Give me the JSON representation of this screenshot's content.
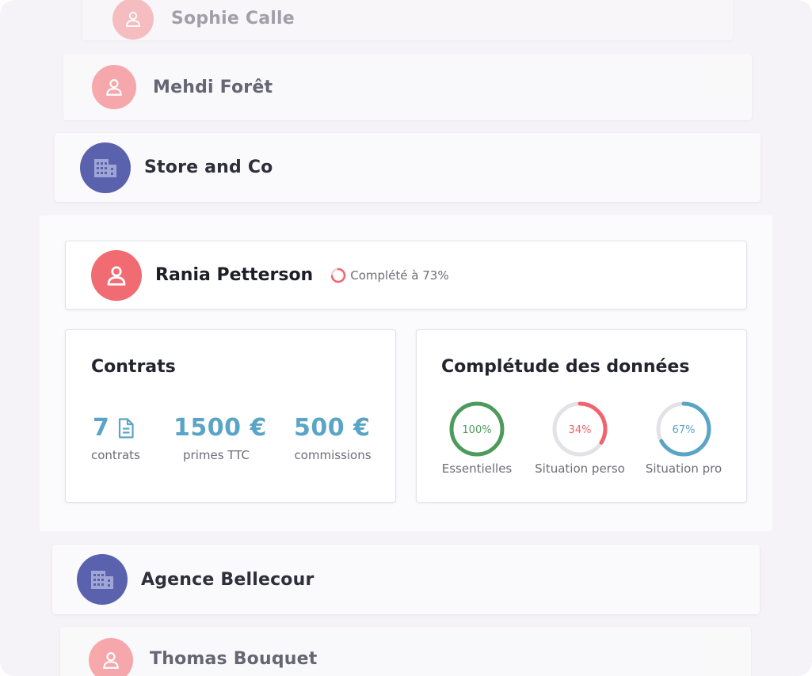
{
  "list_above": [
    {
      "name": "Sophie Calle",
      "type": "person"
    },
    {
      "name": "Mehdi Forêt",
      "type": "person"
    },
    {
      "name": "Store and Co",
      "type": "organization"
    }
  ],
  "selected": {
    "name": "Rania Petterson",
    "completion_text": "Complété à 73%",
    "completion_fraction": 0.73,
    "contracts": {
      "title": "Contrats",
      "count_value": "7",
      "count_label": "contrats",
      "premiums_value": "1500 €",
      "premiums_label": "primes TTC",
      "commissions_value": "500 €",
      "commissions_label": "commissions"
    },
    "data_completeness": {
      "title": "Complétude des données",
      "items": [
        {
          "percent_text": "100%",
          "fraction": 1.0,
          "label": "Essentielles",
          "color": "#4e9a5c"
        },
        {
          "percent_text": "34%",
          "fraction": 0.34,
          "label": "Situation perso",
          "color": "#f06470"
        },
        {
          "percent_text": "67%",
          "fraction": 0.67,
          "label": "Situation pro",
          "color": "#5aa4c6"
        }
      ]
    }
  },
  "list_below": [
    {
      "name": "Agence Bellecour",
      "type": "organization"
    },
    {
      "name": "Thomas Bouquet",
      "type": "person"
    }
  ],
  "colors": {
    "person_avatar": "#f79a9e",
    "org_avatar": "#5a62ad",
    "active_avatar": "#f16b73",
    "accent_blue": "#5aa4c6"
  },
  "icons": {
    "person": "user-icon",
    "organization": "building-icon",
    "document": "document-icon"
  }
}
